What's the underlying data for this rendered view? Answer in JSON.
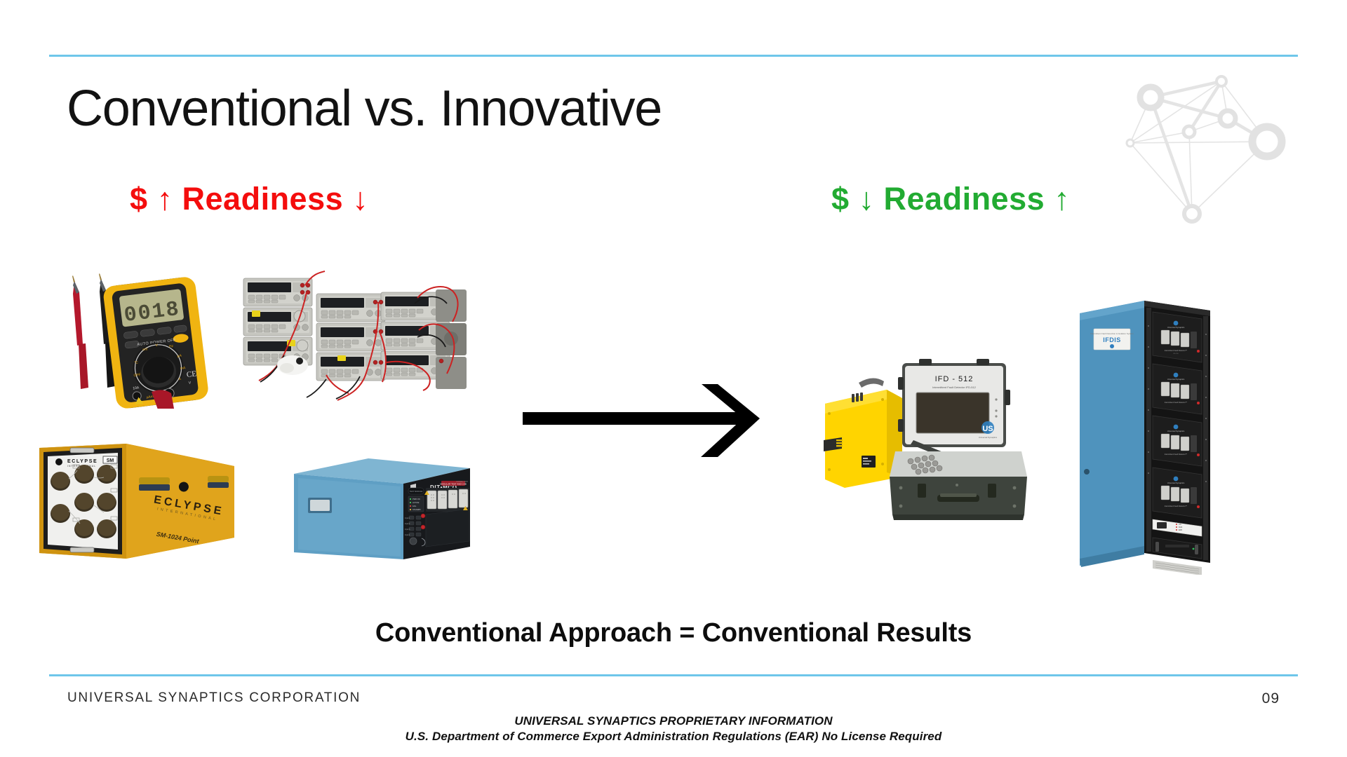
{
  "slide": {
    "title": "Conventional vs. Innovative",
    "page_number": "09",
    "caption": "Conventional Approach = Conventional Results",
    "divider_color": "#6ec6ea"
  },
  "banners": {
    "left": {
      "text": "$ ↑  Readiness ↓",
      "cost_symbol": "$",
      "cost_arrow": "↑",
      "readiness_label": "Readiness",
      "readiness_arrow": "↓",
      "color": "#f40d0d"
    },
    "right": {
      "text": "$ ↓ Readiness ↑",
      "cost_symbol": "$",
      "cost_arrow": "↓",
      "readiness_label": "Readiness",
      "readiness_arrow": "↑",
      "color": "#22ab32"
    }
  },
  "figures": {
    "multimeter": {
      "name": "handheld digital multimeter",
      "display_value": "0018",
      "body_color": "#f2b716",
      "panel_color": "#1b1b1b",
      "probe_colors": [
        "#cc1122",
        "#1a1a1a"
      ],
      "panel_text": "AUTO POWER OFF",
      "mark": "CE"
    },
    "bench_stack": {
      "name": "benchtop test instrument stack",
      "unit_count": 9,
      "cable_colors": [
        "#d32424",
        "#1a1a1a"
      ],
      "chassis_color": "#c9c9c4"
    },
    "eclypse": {
      "name": "switch matrix chassis",
      "brand": "ECLYPSE",
      "sub_brand": "INTERNATIONAL",
      "model": "SM-1024 Point",
      "badge": "SM",
      "body_color": "#e0a41c",
      "connector_count": 8
    },
    "ditmco": {
      "name": "modular wiring analyzer",
      "brand": "DIT•MCO",
      "subtitle": "MODULAR TEST AND ...",
      "body_color": "#5f9fc4",
      "panel_color": "#17191c",
      "connector_count": 6,
      "led_labels": [
        "PWR ON",
        "ACTIVE",
        "FAIL",
        "STANDBY"
      ]
    },
    "ifd_case": {
      "name": "portable intermittent fault detector",
      "model": "IFD - 512",
      "model_subtitle": "Intermittent Fault Detector IFD-512",
      "brand_mark": "US",
      "brand_sub": "Universal Synaptics",
      "case_color": "#3e443d",
      "lid_color": "#e8e8e6",
      "screen_color": "#3a342a",
      "companion_case_color": "#ffd400"
    },
    "ifdis_rack": {
      "name": "rack mounted fault detection system",
      "label": "IFDIS",
      "label_sub": "Intermittent Fault Detection & Isolation System",
      "brand_mark": "US",
      "module_count": 4,
      "module_label": "Intermittent Fault Detector",
      "cabinet_color": "#4f93bd",
      "panel_color": "#141414"
    }
  },
  "arrow": {
    "name": "transition arrow",
    "direction": "right",
    "color": "#000000"
  },
  "network_logo": {
    "name": "network node graph watermark",
    "node_count": 7,
    "color": "#e2e2e2"
  },
  "footer": {
    "company": "UNIVERSAL SYNAPTICS CORPORATION",
    "proprietary_line1": "UNIVERSAL SYNAPTICS PROPRIETARY INFORMATION",
    "proprietary_line2": "U.S. Department of Commerce Export Administration Regulations (EAR) No License Required"
  }
}
